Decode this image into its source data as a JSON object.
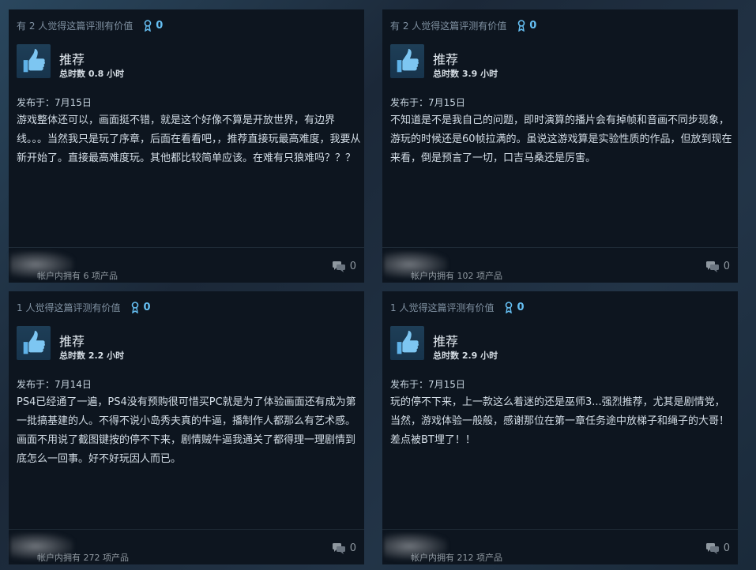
{
  "reviews": [
    {
      "helpful": "有 2 人觉得这篇评测有价值",
      "awards": "0",
      "title": "推荐",
      "hours": "总时数 0.8 小时",
      "posted": "发布于：7月15日",
      "body": "游戏整体还可以，画面挺不错，就是这个好像不算是开放世界，有边界线。。。当然我只是玩了序章，后面在看看吧，，推荐直接玩最高难度，我要从新开始了。直接最高难度玩。其他都比较简单应该。在难有只狼难吗？？？",
      "owned": "帐户内拥有 6 项产品",
      "comments": "0"
    },
    {
      "helpful": "有 2 人觉得这篇评测有价值",
      "awards": "0",
      "title": "推荐",
      "hours": "总时数 3.9 小时",
      "posted": "发布于：7月15日",
      "body": "不知道是不是我自己的问题，即时演算的播片会有掉帧和音画不同步现象，游玩的时候还是60帧拉满的。虽说这游戏算是实验性质的作品，但放到现在来看，倒是预言了一切，口吉马桑还是厉害。",
      "owned": "帐户内拥有 102 项产品",
      "comments": "0"
    },
    {
      "helpful": "1 人觉得这篇评测有价值",
      "awards": "0",
      "title": "推荐",
      "hours": "总时数 2.2 小时",
      "posted": "发布于：7月14日",
      "body": "PS4已经通了一遍，PS4没有预购很可惜买PC就是为了体验画面还有成为第一批搞基建的人。不得不说小岛秀夫真的牛逼，播制作人都那么有艺术感。画面不用说了截图键按的停不下来，剧情贼牛逼我通关了都得理一理剧情到底怎么一回事。好不好玩因人而已。",
      "owned": "帐户内拥有 272 项产品",
      "comments": "0"
    },
    {
      "helpful": "1 人觉得这篇评测有价值",
      "awards": "0",
      "title": "推荐",
      "hours": "总时数 2.9 小时",
      "posted": "发布于：7月15日",
      "body": "玩的停不下来，上一款这么着迷的还是巫师3...强烈推荐，尤其是剧情党，当然，游戏体验一般般，感谢那位在第一章任务途中放梯子和绳子的大哥！差点被BT埋了！！",
      "owned": "帐户内拥有 212 项产品",
      "comments": "0"
    }
  ],
  "colors": {
    "accent": "#66c0f4",
    "card_bg": "#0d151f",
    "page_bg": "#1b2838"
  }
}
